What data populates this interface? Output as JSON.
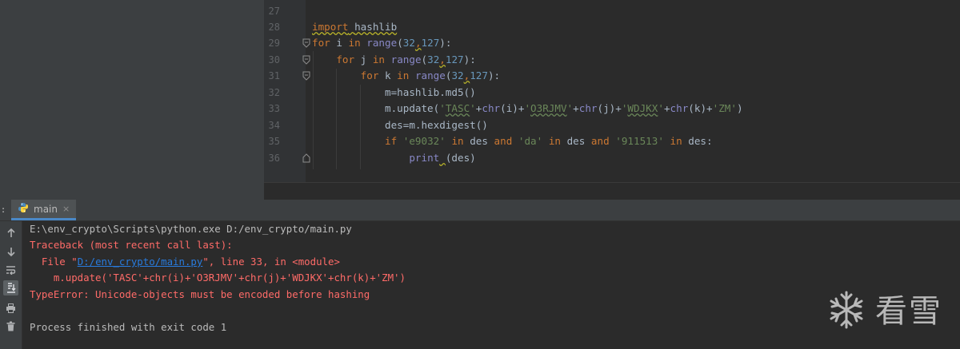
{
  "editor": {
    "line_numbers": [
      "27",
      "28",
      "29",
      "30",
      "31",
      "32",
      "33",
      "34",
      "35",
      "36"
    ],
    "lines": {
      "l28": {
        "t1": "import",
        "t2": " ",
        "t3": "hashlib"
      },
      "l29": {
        "t1": "for",
        "t2": " i ",
        "t3": "in",
        "t4": " ",
        "t5": "range",
        "t6": "(",
        "t7": "32",
        "t8": ",",
        "t9": "127",
        "t10": "):"
      },
      "l30": {
        "t1": "    ",
        "t2": "for",
        "t3": " j ",
        "t4": "in",
        "t5": " ",
        "t6": "range",
        "t7": "(",
        "t8": "32",
        "t9": ",",
        "t10": "127",
        "t11": "):"
      },
      "l31": {
        "t1": "        ",
        "t2": "for",
        "t3": " k ",
        "t4": "in",
        "t5": " ",
        "t6": "range",
        "t7": "(",
        "t8": "32",
        "t9": ",",
        "t10": "127",
        "t11": "):"
      },
      "l32": {
        "t1": "            m=hashlib.md5()"
      },
      "l33": {
        "t1": "            m.update(",
        "t2": "'",
        "t3": "TASC",
        "t4": "'",
        "t5": "+",
        "t6": "chr",
        "t7": "(i)+",
        "t8": "'",
        "t9": "O3RJMV",
        "t10": "'",
        "t11": "+",
        "t12": "chr",
        "t13": "(j)+",
        "t14": "'",
        "t15": "WDJKX",
        "t16": "'",
        "t17": "+",
        "t18": "chr",
        "t19": "(k)+",
        "t20": "'ZM'",
        "t21": ")"
      },
      "l34": {
        "t1": "            des=m.hexdigest()"
      },
      "l35": {
        "t1": "            ",
        "t2": "if",
        "t3": " ",
        "t4": "'e9032'",
        "t5": " ",
        "t6": "in",
        "t7": " des ",
        "t8": "and",
        "t9": " ",
        "t10": "'da'",
        "t11": " ",
        "t12": "in",
        "t13": " des ",
        "t14": "and",
        "t15": " ",
        "t16": "'911513'",
        "t17": " ",
        "t18": "in",
        "t19": " des:"
      },
      "l36": {
        "t1": "                ",
        "t2": "print",
        "t3": " ",
        "t4": "(des)"
      }
    }
  },
  "run_panel": {
    "tab_label": "main",
    "tab_close": "×",
    "left_stub": ":",
    "icons": [
      "arrow-up-icon",
      "arrow-down-icon",
      "soft-wrap-icon",
      "scroll-to-end-icon",
      "print-icon",
      "trash-icon"
    ],
    "console": {
      "cmd": "E:\\env_crypto\\Scripts\\python.exe D:/env_crypto/main.py",
      "traceback": "Traceback (most recent call last):",
      "file_prefix": "  File \"",
      "file_link": "D:/env_crypto/main.py",
      "file_suffix": "\", line 33, in <module>",
      "code": "    m.update('TASC'+chr(i)+'O3RJMV'+chr(j)+'WDJKX'+chr(k)+'ZM')",
      "error": "TypeError: Unicode-objects must be encoded before hashing",
      "finished": "Process finished with exit code 1"
    }
  },
  "watermark": {
    "text": "看雪",
    "icon": "snowflake-icon"
  },
  "colors": {
    "keyword": "#cc7832",
    "builtin": "#8888c6",
    "number": "#6897bb",
    "string": "#6a8759",
    "error": "#ff6b68",
    "link": "#287bde",
    "text": "#a9b7c6"
  }
}
